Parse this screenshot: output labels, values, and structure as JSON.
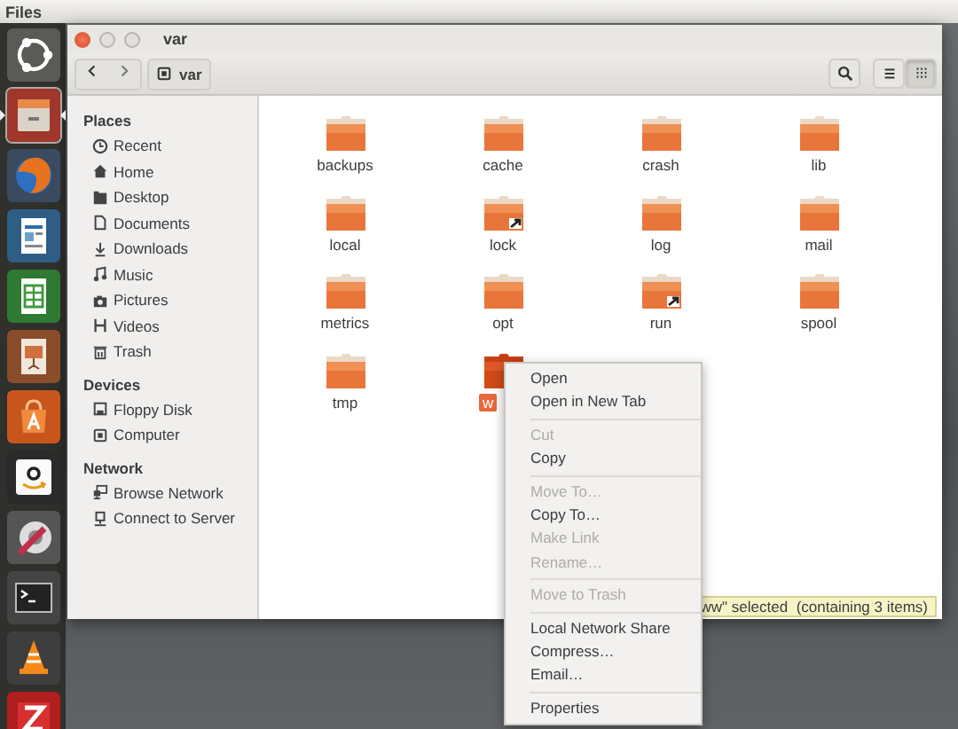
{
  "top_bar": {
    "title": "Files"
  },
  "launcher": [
    {
      "kind": "logo",
      "selected": false
    },
    {
      "kind": "files",
      "selected": true
    },
    {
      "kind": "browser",
      "selected": false
    },
    {
      "kind": "writer",
      "selected": false
    },
    {
      "kind": "calc",
      "selected": false
    },
    {
      "kind": "impress",
      "selected": false
    },
    {
      "kind": "store",
      "selected": false
    },
    {
      "kind": "shop",
      "selected": false
    },
    {
      "kind": "settings",
      "selected": false
    },
    {
      "kind": "terminal",
      "selected": false
    },
    {
      "kind": "cone",
      "selected": false
    },
    {
      "kind": "ftp",
      "selected": false
    }
  ],
  "window": {
    "title": "var"
  },
  "toolbar": {
    "path": "var",
    "views": [
      {
        "kind": "list",
        "selected": false
      },
      {
        "kind": "grid",
        "selected": true
      }
    ]
  },
  "sidebar": {
    "sections": [
      {
        "heading": "Places",
        "items": [
          {
            "label": "Recent",
            "kind": "recent"
          },
          {
            "label": "Home",
            "kind": "home"
          },
          {
            "label": "Desktop",
            "kind": "desktop"
          },
          {
            "label": "Documents",
            "kind": "documents"
          },
          {
            "label": "Downloads",
            "kind": "downloads"
          },
          {
            "label": "Music",
            "kind": "music"
          },
          {
            "label": "Pictures",
            "kind": "pictures"
          },
          {
            "label": "Videos",
            "kind": "videos"
          },
          {
            "label": "Trash",
            "kind": "trash"
          }
        ]
      },
      {
        "heading": "Devices",
        "items": [
          {
            "label": "Floppy Disk",
            "kind": "floppy"
          },
          {
            "label": "Computer",
            "kind": "computer"
          }
        ]
      },
      {
        "heading": "Network",
        "items": [
          {
            "label": "Browse Network",
            "kind": "network"
          },
          {
            "label": "Connect to Server",
            "kind": "server"
          }
        ]
      }
    ]
  },
  "files": [
    {
      "name": "backups",
      "kind": "folder",
      "selected": false
    },
    {
      "name": "cache",
      "kind": "folder",
      "selected": false
    },
    {
      "name": "crash",
      "kind": "folder",
      "selected": false
    },
    {
      "name": "lib",
      "kind": "folder",
      "selected": false
    },
    {
      "name": "local",
      "kind": "folder",
      "selected": false
    },
    {
      "name": "lock",
      "kind": "link",
      "selected": false
    },
    {
      "name": "log",
      "kind": "folder",
      "selected": false
    },
    {
      "name": "mail",
      "kind": "folder",
      "selected": false
    },
    {
      "name": "metrics",
      "kind": "folder",
      "selected": false
    },
    {
      "name": "opt",
      "kind": "folder",
      "selected": false
    },
    {
      "name": "run",
      "kind": "link",
      "selected": false
    },
    {
      "name": "spool",
      "kind": "folder",
      "selected": false
    },
    {
      "name": "tmp",
      "kind": "folder",
      "selected": false
    },
    {
      "name": "w",
      "kind": "folder",
      "selected": true
    }
  ],
  "status": "ww\" selected  (containing 3 items)",
  "context_menu": {
    "groups": [
      [
        {
          "label": "Open",
          "disabled": false
        },
        {
          "label": "Open in New Tab",
          "disabled": false
        }
      ],
      [
        {
          "label": "Cut",
          "disabled": true
        },
        {
          "label": "Copy",
          "disabled": false
        }
      ],
      [
        {
          "label": "Move To…",
          "disabled": true
        },
        {
          "label": "Copy To…",
          "disabled": false
        },
        {
          "label": "Make Link",
          "disabled": true
        },
        {
          "label": "Rename…",
          "disabled": true
        }
      ],
      [
        {
          "label": "Move to Trash",
          "disabled": true
        }
      ],
      [
        {
          "label": "Local Network Share",
          "disabled": false
        },
        {
          "label": "Compress…",
          "disabled": false
        },
        {
          "label": "Email…",
          "disabled": false
        }
      ],
      [
        {
          "label": "Properties",
          "disabled": false
        }
      ]
    ]
  }
}
